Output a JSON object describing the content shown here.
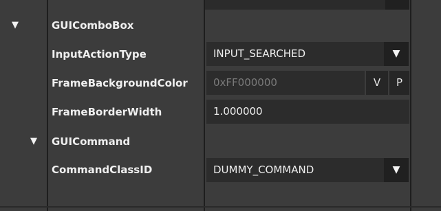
{
  "colors": {
    "panel_bg": "#3c3c3c",
    "field_bg": "#2c2c2c",
    "button_bg": "#202020",
    "text": "#efefef",
    "muted_text": "#7a7a7a"
  },
  "tree": {
    "combo_box": {
      "arrow": "▼",
      "label": "GUIComboBox"
    },
    "command": {
      "arrow": "▼",
      "label": "GUICommand"
    }
  },
  "properties": {
    "input_action_type": {
      "label": "InputActionType",
      "value": "INPUT_SEARCHED",
      "dropdown": "▼"
    },
    "frame_background_color": {
      "label": "FrameBackgroundColor",
      "value": "0xFF000000",
      "btn_v": "V",
      "btn_p": "P"
    },
    "frame_border_width": {
      "label": "FrameBorderWidth",
      "value": "1.000000"
    },
    "command_class_id": {
      "label": "CommandClassID",
      "value": "DUMMY_COMMAND",
      "dropdown": "▼"
    }
  }
}
